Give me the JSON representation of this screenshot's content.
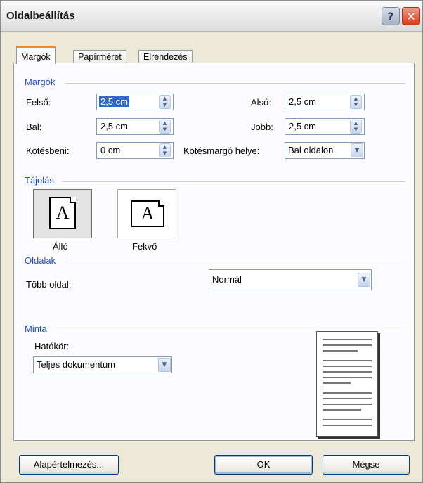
{
  "window": {
    "title": "Oldalbeállítás"
  },
  "titlebar_buttons": {
    "help": "?",
    "close": "✕"
  },
  "tabs": [
    {
      "label": "Margók",
      "active": true
    },
    {
      "label": "Papírméret",
      "active": false
    },
    {
      "label": "Elrendezés",
      "active": false
    }
  ],
  "margins": {
    "group_title": "Margók",
    "top_label": "Felső:",
    "top_value": "2,5 cm",
    "bottom_label": "Alsó:",
    "bottom_value": "2,5 cm",
    "left_label": "Bal:",
    "left_value": "2,5 cm",
    "right_label": "Jobb:",
    "right_value": "2,5 cm",
    "gutter_label": "Kötésbeni:",
    "gutter_value": "0 cm",
    "gutter_pos_label": "Kötésmargó helye:",
    "gutter_pos_value": "Bal oldalon"
  },
  "orientation": {
    "group_title": "Tájolás",
    "portrait_label": "Álló",
    "landscape_label": "Fekvő",
    "icon_glyph": "A",
    "selected": "portrait"
  },
  "pages": {
    "group_title": "Oldalak",
    "multiple_label": "Több oldal:",
    "multiple_value": "Normál"
  },
  "preview": {
    "group_title": "Minta",
    "apply_label": "Hatókör:",
    "apply_value": "Teljes dokumentum"
  },
  "buttons": {
    "default": "Alapértelmezés...",
    "ok": "OK",
    "cancel": "Mégse"
  },
  "icons": {
    "spin_up": "▲",
    "spin_down": "▼",
    "dropdown": "▼"
  },
  "colors": {
    "group_title": "#1f4fc6",
    "active_tab_accent": "#e68b2c",
    "selection": "#316ac5"
  }
}
